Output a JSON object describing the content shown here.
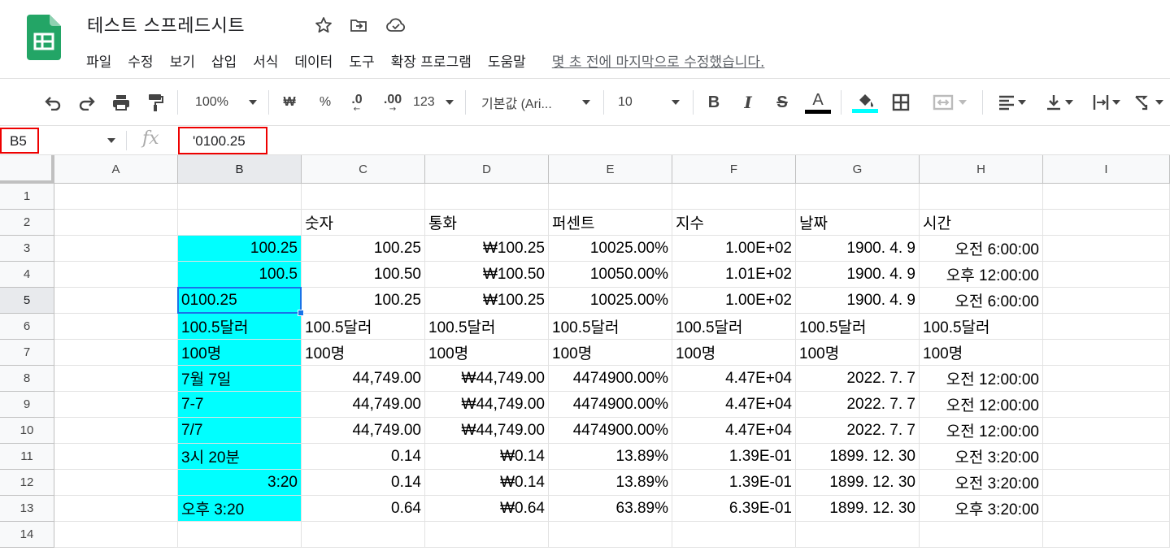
{
  "app": {
    "title": "테스트 스프레드시트",
    "menus": [
      "파일",
      "수정",
      "보기",
      "삽입",
      "서식",
      "데이터",
      "도구",
      "확장 프로그램",
      "도움말"
    ],
    "last_edit": "몇 초 전에 마지막으로 수정했습니다."
  },
  "toolbar": {
    "zoom": "100%",
    "currency": "₩",
    "percent": "%",
    "dec_less": ".0",
    "dec_more": ".00",
    "format_more": "123",
    "font": "기본값 (Ari...",
    "font_size": "10",
    "bold": "B",
    "italic": "I",
    "strike": "S",
    "text_color_glyph": "A",
    "text_color": "#000000",
    "fill_color": "#00ffff"
  },
  "formula_bar": {
    "name_box": "B5",
    "fx": "fx",
    "formula": "'0100.25"
  },
  "grid": {
    "columns": [
      "A",
      "B",
      "C",
      "D",
      "E",
      "F",
      "G",
      "H",
      "I"
    ],
    "selected_column": "B",
    "rows": [
      "1",
      "2",
      "3",
      "4",
      "5",
      "6",
      "7",
      "8",
      "9",
      "10",
      "11",
      "12",
      "13",
      "14"
    ],
    "selected_row": "5",
    "highlight_color": "#00ffff",
    "cells": [
      [
        "",
        "",
        "",
        "",
        "",
        "",
        "",
        "",
        ""
      ],
      [
        "",
        "",
        "숫자",
        "통화",
        "퍼센트",
        "지수",
        "날짜",
        "시간",
        ""
      ],
      [
        "",
        "100.25",
        "100.25",
        "₩100.25",
        "10025.00%",
        "1.00E+02",
        "1900. 4. 9",
        "오전 6:00:00",
        ""
      ],
      [
        "",
        "100.5",
        "100.50",
        "₩100.50",
        "10050.00%",
        "1.01E+02",
        "1900. 4. 9",
        "오후 12:00:00",
        ""
      ],
      [
        "",
        "0100.25",
        "100.25",
        "₩100.25",
        "10025.00%",
        "1.00E+02",
        "1900. 4. 9",
        "오전 6:00:00",
        ""
      ],
      [
        "",
        "100.5달러",
        "100.5달러",
        "100.5달러",
        "100.5달러",
        "100.5달러",
        "100.5달러",
        "100.5달러",
        ""
      ],
      [
        "",
        "100명",
        "100명",
        "100명",
        "100명",
        "100명",
        "100명",
        "100명",
        ""
      ],
      [
        "",
        "7월 7일",
        "44,749.00",
        "₩44,749.00",
        "4474900.00%",
        "4.47E+04",
        "2022. 7. 7",
        "오전 12:00:00",
        ""
      ],
      [
        "",
        "7-7",
        "44,749.00",
        "₩44,749.00",
        "4474900.00%",
        "4.47E+04",
        "2022. 7. 7",
        "오전 12:00:00",
        ""
      ],
      [
        "",
        "7/7",
        "44,749.00",
        "₩44,749.00",
        "4474900.00%",
        "4.47E+04",
        "2022. 7. 7",
        "오전 12:00:00",
        ""
      ],
      [
        "",
        "3시 20분",
        "0.14",
        "₩0.14",
        "13.89%",
        "1.39E-01",
        "1899. 12. 30",
        "오전 3:20:00",
        ""
      ],
      [
        "",
        "3:20",
        "0.14",
        "₩0.14",
        "13.89%",
        "1.39E-01",
        "1899. 12. 30",
        "오전 3:20:00",
        ""
      ],
      [
        "",
        "오후 3:20",
        "0.64",
        "₩0.64",
        "63.89%",
        "6.39E-01",
        "1899. 12. 30",
        "오후 3:20:00",
        ""
      ],
      [
        "",
        "",
        "",
        "",
        "",
        "",
        "",
        "",
        ""
      ]
    ],
    "align": [
      [
        "l",
        "l",
        "l",
        "l",
        "l",
        "l",
        "l",
        "l",
        "l"
      ],
      [
        "l",
        "l",
        "l",
        "l",
        "l",
        "l",
        "l",
        "l",
        "l"
      ],
      [
        "l",
        "r",
        "r",
        "r",
        "r",
        "r",
        "r",
        "r",
        "l"
      ],
      [
        "l",
        "r",
        "r",
        "r",
        "r",
        "r",
        "r",
        "r",
        "l"
      ],
      [
        "l",
        "l",
        "r",
        "r",
        "r",
        "r",
        "r",
        "r",
        "l"
      ],
      [
        "l",
        "l",
        "l",
        "l",
        "l",
        "l",
        "l",
        "l",
        "l"
      ],
      [
        "l",
        "l",
        "l",
        "l",
        "l",
        "l",
        "l",
        "l",
        "l"
      ],
      [
        "l",
        "l",
        "r",
        "r",
        "r",
        "r",
        "r",
        "r",
        "l"
      ],
      [
        "l",
        "l",
        "r",
        "r",
        "r",
        "r",
        "r",
        "r",
        "l"
      ],
      [
        "l",
        "l",
        "r",
        "r",
        "r",
        "r",
        "r",
        "r",
        "l"
      ],
      [
        "l",
        "l",
        "r",
        "r",
        "r",
        "r",
        "r",
        "r",
        "l"
      ],
      [
        "l",
        "r",
        "r",
        "r",
        "r",
        "r",
        "r",
        "r",
        "l"
      ],
      [
        "l",
        "l",
        "r",
        "r",
        "r",
        "r",
        "r",
        "r",
        "l"
      ],
      [
        "l",
        "l",
        "l",
        "l",
        "l",
        "l",
        "l",
        "l",
        "l"
      ]
    ],
    "highlighted_rows_in_B": [
      "3",
      "4",
      "5",
      "6",
      "7",
      "8",
      "9",
      "10",
      "11",
      "12",
      "13"
    ]
  }
}
